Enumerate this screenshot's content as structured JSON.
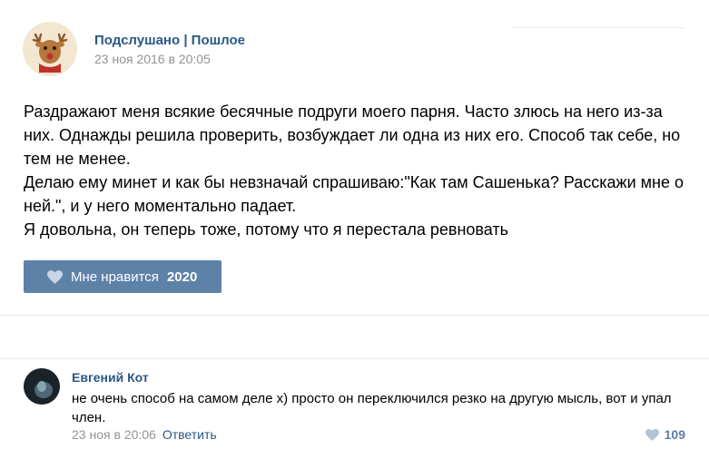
{
  "post": {
    "author": "Подслушано | Пошлое",
    "date": "23 ноя 2016 в 20:05",
    "avatar_icon": "deer-avatar-icon",
    "paragraphs": [
      "Раздражают меня всякие бесячные подруги моего парня. Часто злюсь на него из-за них. Однажды решила проверить, возбуждает ли одна из них его. Способ так себе, но тем не менее.",
      "Делаю ему минет и как бы невзначай спрашиваю:\"Как там Сашенька? Расскажи мне о ней.\", и у него моментально падает.",
      "Я довольна, он теперь тоже, потому что я перестала ревновать"
    ],
    "like_label": "Мне нравится",
    "like_count": "2020"
  },
  "comment": {
    "author": "Евгений Кот",
    "text": "не очень способ на самом деле x) просто он переключился резко на другую мысль, вот и упал член.",
    "date": "23 ноя в 20:06",
    "reply_label": "Ответить",
    "like_count": "109"
  },
  "colors": {
    "link": "#2a5885",
    "like_button": "#5e81a8",
    "meta": "#939393"
  }
}
